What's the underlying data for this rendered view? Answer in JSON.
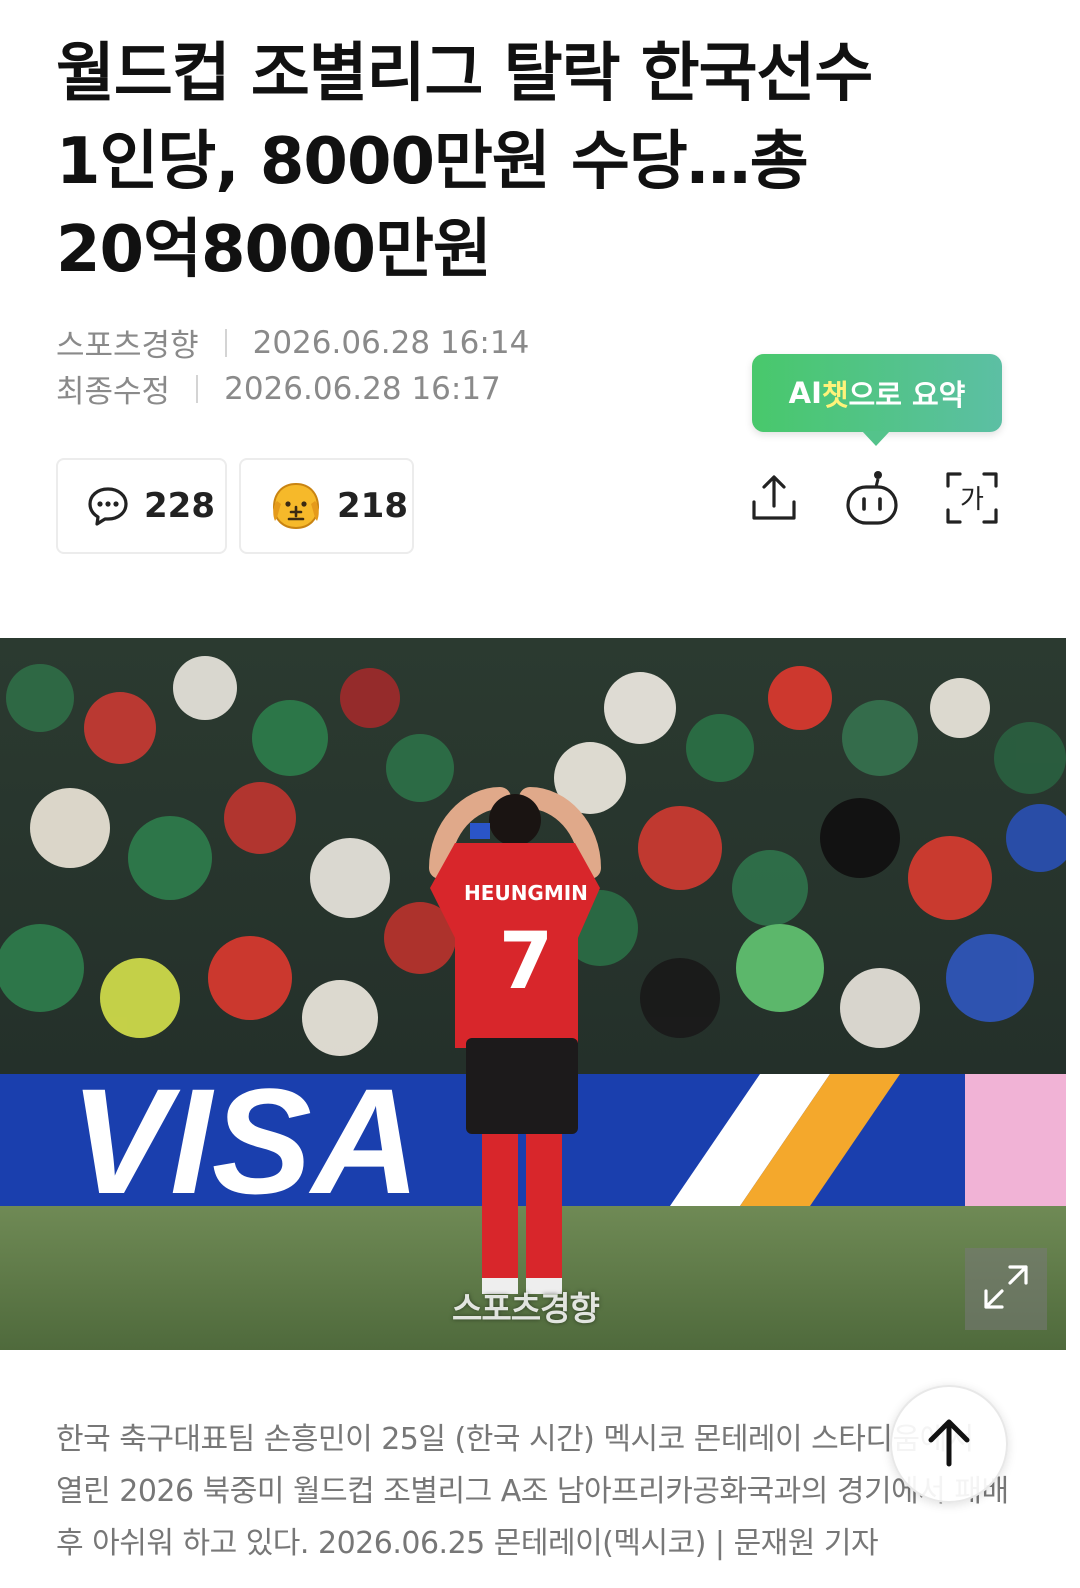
{
  "article": {
    "title": "월드컵 조별리그 탈락 한국선수 1인당, 8000만원 수당…총 20억8000만원",
    "source": "스포츠경향",
    "published_at": "2026.06.28 16:14",
    "modified_label": "최종수정",
    "modified_at": "2026.06.28 16:17"
  },
  "reactions": {
    "comments_count": "228",
    "likes_count": "218"
  },
  "toolbar": {
    "ai_summary_prefix": "AI",
    "ai_summary_highlight": "챗",
    "ai_summary_suffix": "으로 요약",
    "share_icon": "share-icon",
    "bot_icon": "bot-icon",
    "font_icon_text": "가"
  },
  "photo": {
    "jersey_name": "HEUNGMIN",
    "jersey_number": "7",
    "ad_board_text": "VISA",
    "watermark": "스포츠경향"
  },
  "caption": "한국 축구대표팀 손흥민이 25일 (한국 시간) 멕시코 몬테레이 스타디움에서 열린 2026 북중미 월드컵 조별리그 A조 남아프리카공화국과의 경기에서 패배 후 아쉬워 하고 있다. 2026.06.25 몬테레이(멕시코) | 문재원 기자",
  "colors": {
    "ai_gradient_start": "#48c86b",
    "ai_gradient_end": "#5cbfa4",
    "jersey_red": "#d8262b",
    "visa_blue": "#1a3fae",
    "visa_gold": "#f4a82c"
  }
}
